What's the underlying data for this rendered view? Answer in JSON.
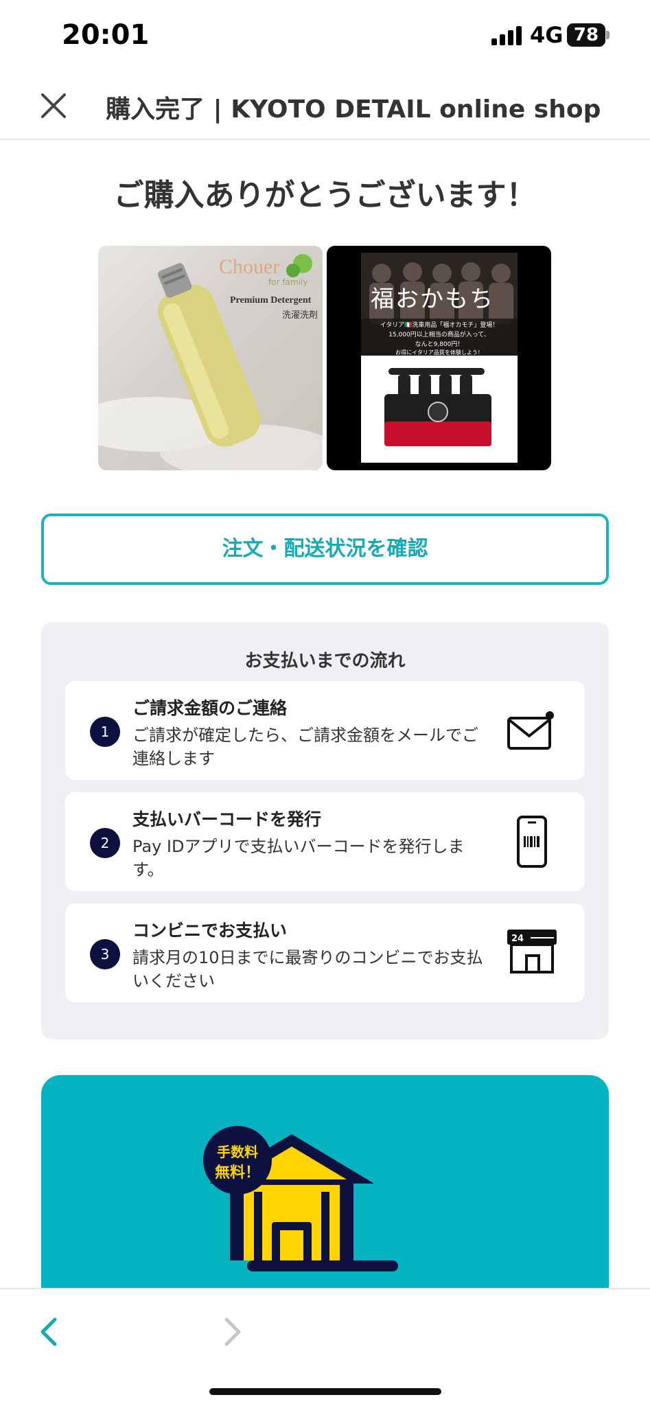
{
  "status_bar": {
    "time": "20:01",
    "network": "4G",
    "battery": "78"
  },
  "navbar": {
    "title": "購入完了 | KYOTO DETAIL online shop"
  },
  "main": {
    "heading": "ご購入ありがとうございます！",
    "product1": {
      "brand": "Chouer",
      "brand_sub": "for family",
      "name_en": "Premium Detergent",
      "name_ja": "洗濯洗剤"
    },
    "product2": {
      "title": "福おかもち",
      "line1": "イタリア🇮🇹洗車用品「福オカモチ」登場！",
      "line2": "15,000円以上相当の商品が入って、",
      "line3": "なんと9,800円！",
      "line4": "お得にイタリア品質を体験しよう！"
    },
    "status_button": "注文・配送状況を確認"
  },
  "flow": {
    "title": "お支払いまでの流れ",
    "steps": [
      {
        "num": "1",
        "title": "ご請求金額のご連絡",
        "desc": "ご請求が確定したら、ご請求金額をメールでご連絡します",
        "icon": "mail-icon"
      },
      {
        "num": "2",
        "title": "支払いバーコードを発行",
        "desc": "Pay IDアプリで支払いバーコードを発行します。",
        "icon": "phone-barcode-icon"
      },
      {
        "num": "3",
        "title": "コンビニでお支払い",
        "desc": "請求月の10日までに最寄りのコンビニでお支払いください",
        "icon": "store-icon",
        "store_badge": "24"
      }
    ]
  },
  "promo": {
    "badge_line1": "手数料",
    "badge_line2": "無料！"
  },
  "colors": {
    "accent": "#18b3bd",
    "navy": "#0d1140",
    "promo_bg": "#06b4c1",
    "yellow": "#ffd400"
  }
}
